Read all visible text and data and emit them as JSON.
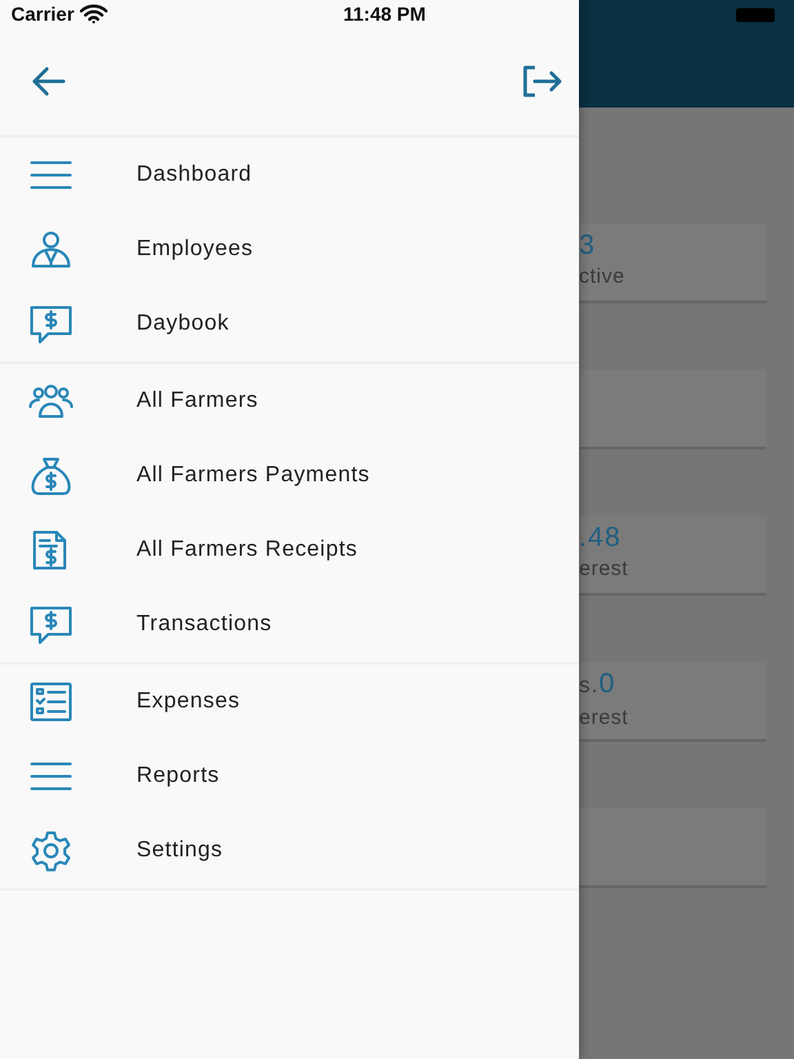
{
  "status_bar": {
    "carrier": "Carrier",
    "time": "11:48 PM"
  },
  "drawer": {
    "groups": [
      [
        {
          "label": "Dashboard"
        },
        {
          "label": "Employees"
        },
        {
          "label": "Daybook"
        }
      ],
      [
        {
          "label": "All Farmers"
        },
        {
          "label": "All Farmers Payments"
        },
        {
          "label": "All Farmers Receipts"
        },
        {
          "label": "Transactions"
        }
      ],
      [
        {
          "label": "Expenses"
        },
        {
          "label": "Reports"
        },
        {
          "label": "Settings"
        }
      ]
    ]
  },
  "background_cards": [
    {
      "kind": "stat",
      "value": "3",
      "label": "ctive"
    },
    {
      "kind": "empty"
    },
    {
      "kind": "stat",
      "value": ".48",
      "label": "erest"
    },
    {
      "kind": "stat",
      "prefix": "s.",
      "value": "0",
      "label": "erest"
    },
    {
      "kind": "empty"
    }
  ]
}
